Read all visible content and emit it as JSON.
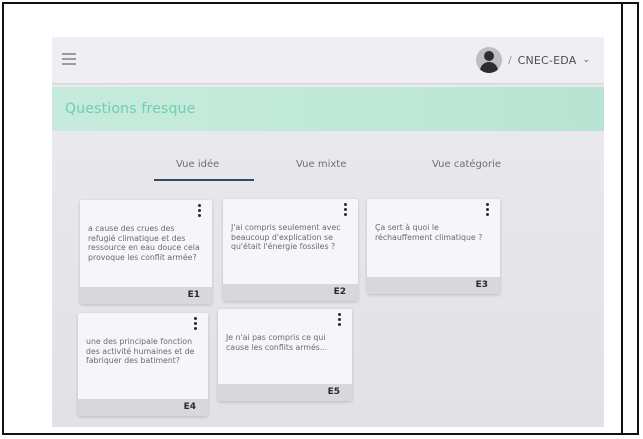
{
  "header": {
    "menu_icon": "hamburger-menu-icon",
    "user_separator": "/",
    "user_name": "CNEC-EDA",
    "chevron": "⌄"
  },
  "page": {
    "title": "Questions fresque"
  },
  "tabs": [
    {
      "label": "Vue idée",
      "active": true
    },
    {
      "label": "Vue mixte",
      "active": false
    },
    {
      "label": "Vue catégorie",
      "active": false
    }
  ],
  "cards": [
    {
      "code": "E1",
      "text": "a cause des crues des refugié climatique et des ressource en eau douce cela provoque les conflit armée?"
    },
    {
      "code": "E2",
      "text": "J'ai compris seulement avec beaucoup d'explication se qu'était l'énergie fossiles ?"
    },
    {
      "code": "E3",
      "text": "Ça sert à quoi le réchauffement climatique ?"
    },
    {
      "code": "E4",
      "text": "une des principale fonction des activité humaines et de fabriquer des batiment?"
    },
    {
      "code": "E5",
      "text": "Je n'ai pas compris ce qui cause les conflits armés..."
    }
  ],
  "colors": {
    "accent": "#6fcfae",
    "title_band": "#c6ebdc",
    "tab_underline": "#2f4a6d"
  }
}
